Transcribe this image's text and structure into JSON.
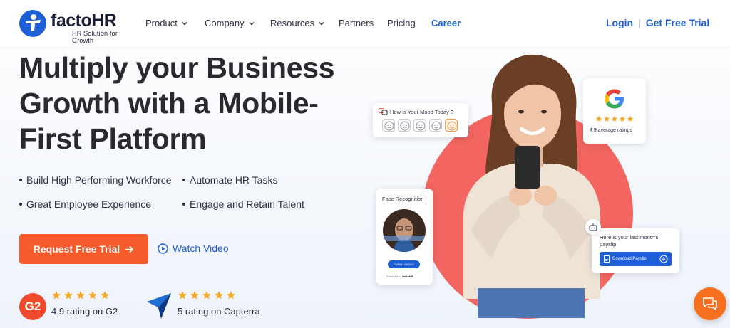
{
  "brand": {
    "name": "factoHR",
    "tagline": "HR Solution for Growth",
    "primary": "#1f5fd6",
    "accent": "#f65c2b"
  },
  "nav": {
    "items": [
      {
        "label": "Product",
        "dropdown": true
      },
      {
        "label": "Company",
        "dropdown": true
      },
      {
        "label": "Resources",
        "dropdown": true
      },
      {
        "label": "Partners",
        "dropdown": false
      },
      {
        "label": "Pricing",
        "dropdown": false
      },
      {
        "label": "Career",
        "dropdown": false
      }
    ],
    "login": "Login",
    "separator": "|",
    "trial": "Get Free Trial"
  },
  "hero": {
    "title_lines": [
      "Multiply your Business",
      "Growth with a Mobile-",
      "First Platform"
    ],
    "bullets": [
      "Build High Performing Workforce",
      "Automate HR Tasks",
      "Great Employee Experience",
      "Engage and Retain Talent"
    ],
    "cta": "Request Free Trial",
    "watch": "Watch Video"
  },
  "ratings": [
    {
      "badge": "G2",
      "stars": 5,
      "text": "4.9 rating on G2"
    },
    {
      "badge": "capterra-icon",
      "stars": 5,
      "text": "5 rating on Capterra"
    }
  ],
  "cards": {
    "mood": {
      "title": "How Is Your Mood Today ?",
      "selected": 5
    },
    "google": {
      "rating_text": "4.9 average ratings",
      "stars": 5
    },
    "face": {
      "title": "Face Recognition",
      "button": "PUNCH IN/OUT",
      "powered": "Powered by",
      "powered_brand": "factoHR"
    },
    "payslip": {
      "title_line1": "Here is your last month's",
      "title_line2": "payslip",
      "button": "Download Payslip"
    }
  },
  "colors": {
    "circle": "#f26560",
    "star": "#f5a623",
    "chat": "#f6701f"
  }
}
